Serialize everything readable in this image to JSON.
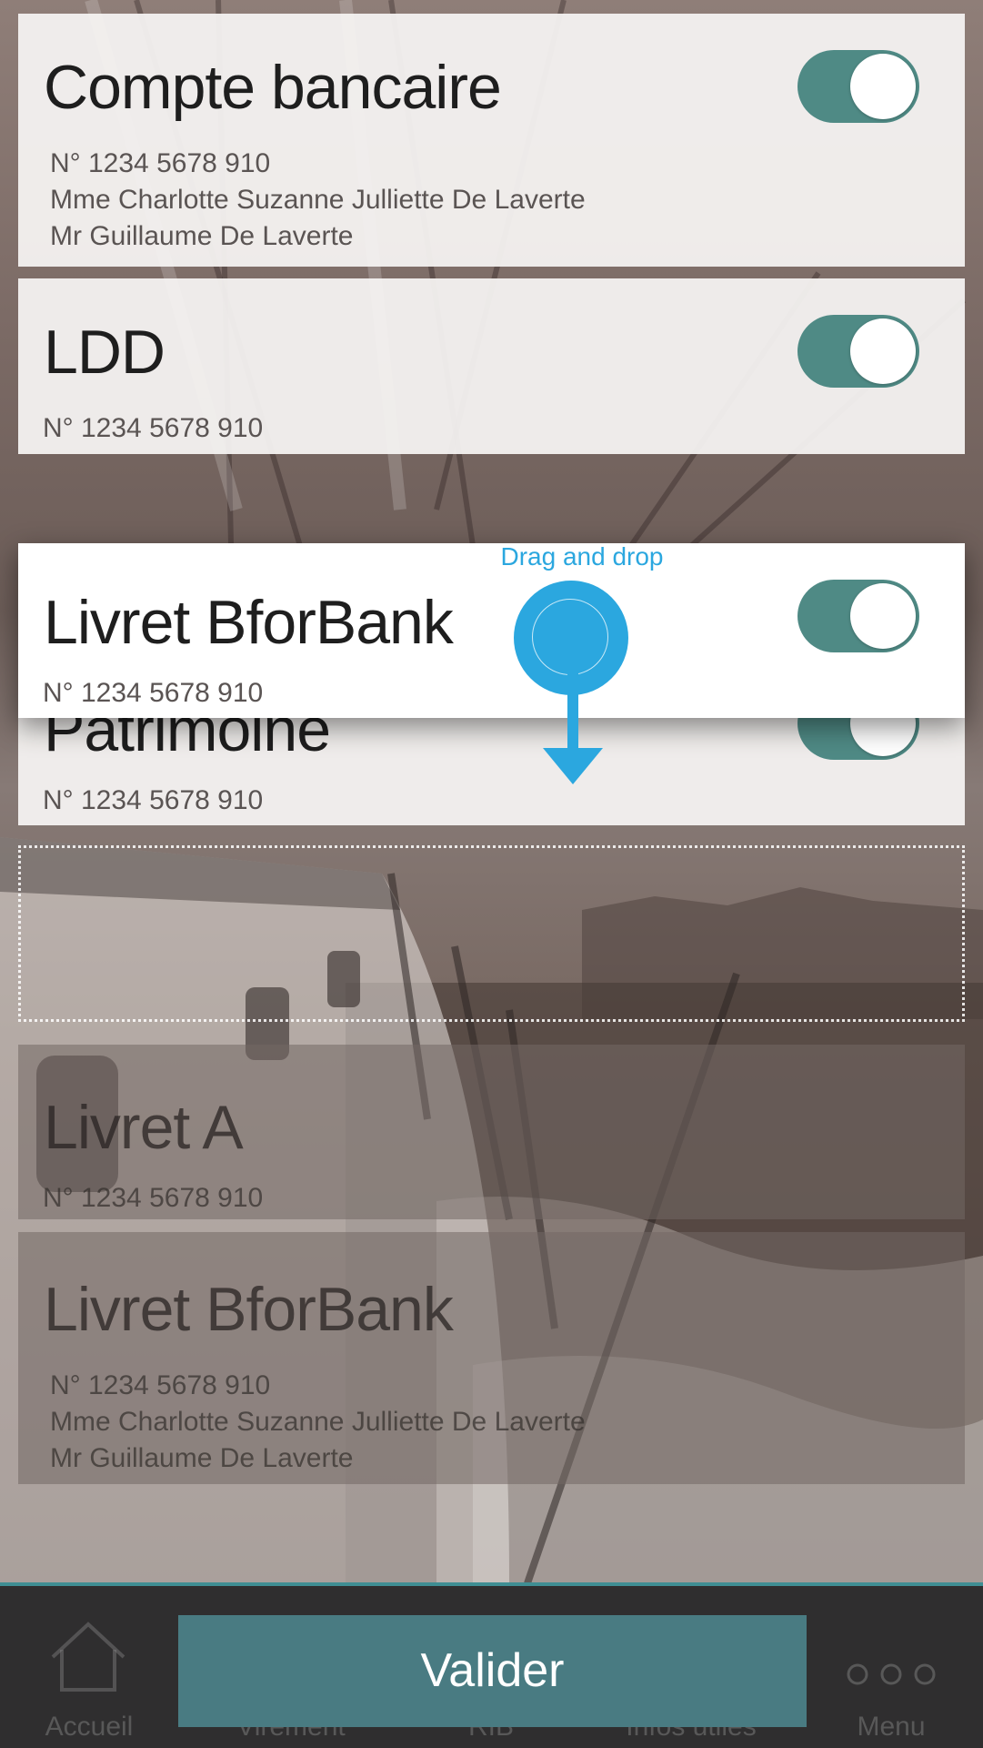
{
  "accounts": [
    {
      "title": "Compte bancaire",
      "lines": [
        "N° 1234 5678 910",
        "Mme Charlotte Suzanne Julliette De Laverte",
        "Mr Guillaume De Laverte"
      ],
      "enabled": true
    },
    {
      "title": "LDD",
      "lines": [
        "N° 1234 5678 910"
      ],
      "enabled": true
    },
    {
      "title": "Patrimoine",
      "lines": [
        "N° 1234 5678 910"
      ],
      "enabled": true
    }
  ],
  "dragged_account": {
    "title": "Livret BforBank",
    "lines": [
      "N° 1234 5678 910"
    ],
    "enabled": true
  },
  "inactive_accounts": [
    {
      "title": "Livret A",
      "lines": [
        "N° 1234 5678 910"
      ]
    },
    {
      "title": "Livret BforBank",
      "lines": [
        "N° 1234 5678 910",
        "Mme Charlotte Suzanne Julliette De Laverte",
        "Mr Guillaume De Laverte"
      ]
    }
  ],
  "drag_hint": "Drag and drop",
  "validate_label": "Valider",
  "nav": {
    "items": [
      "Accueil",
      "Virement",
      "RIB",
      "Infos utiles",
      "Menu"
    ]
  },
  "icons": {
    "home": "home-icon",
    "menu": "more-dots-icon",
    "drag": "drag-handle-icon"
  },
  "colors": {
    "toggle_on": "#4f8a85",
    "accent_blue": "#2ba7df",
    "validate_button": "#497b82",
    "bottom_bar": "#2f2e2f"
  }
}
